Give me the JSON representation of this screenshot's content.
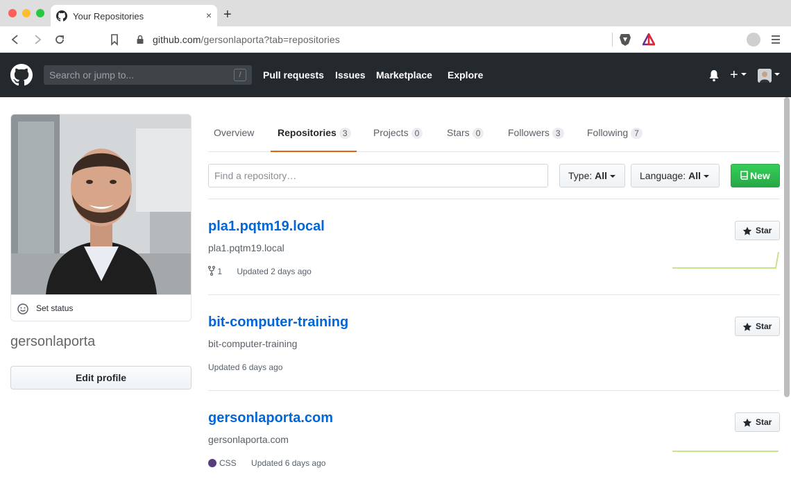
{
  "browser": {
    "tab_title": "Your Repositories",
    "tab_close": "×",
    "new_tab": "+",
    "url_domain": "github.com",
    "url_path": "/gersonlaporta?tab=repositories"
  },
  "header": {
    "search_placeholder": "Search or jump to...",
    "search_shortcut": "/",
    "nav": [
      "Pull requests",
      "Issues",
      "Marketplace",
      "Explore"
    ],
    "plus": "+"
  },
  "profile": {
    "set_status": "Set status",
    "username": "gersonlaporta",
    "edit_profile": "Edit profile"
  },
  "tabs": [
    {
      "label": "Overview",
      "count": null
    },
    {
      "label": "Repositories",
      "count": "3",
      "active": true
    },
    {
      "label": "Projects",
      "count": "0"
    },
    {
      "label": "Stars",
      "count": "0"
    },
    {
      "label": "Followers",
      "count": "3"
    },
    {
      "label": "Following",
      "count": "7"
    }
  ],
  "filters": {
    "find_placeholder": "Find a repository…",
    "type_label": "Type:",
    "type_value": "All",
    "language_label": "Language:",
    "language_value": "All",
    "new_label": "New"
  },
  "repos": [
    {
      "name": "pla1.pqtm19.local",
      "description": "pla1.pqtm19.local",
      "forks": "1",
      "updated": "Updated 2 days ago",
      "star_label": "Star"
    },
    {
      "name": "bit-computer-training",
      "description": "bit-computer-training",
      "updated": "Updated 6 days ago",
      "star_label": "Star"
    },
    {
      "name": "gersonlaporta.com",
      "description": "gersonlaporta.com",
      "language": "CSS",
      "language_color": "#563d7c",
      "updated": "Updated 6 days ago",
      "star_label": "Star"
    }
  ],
  "colors": {
    "header_bg": "#24292e",
    "link": "#0366d6",
    "tab_accent": "#e36209",
    "new_button": "#2ea44f"
  }
}
